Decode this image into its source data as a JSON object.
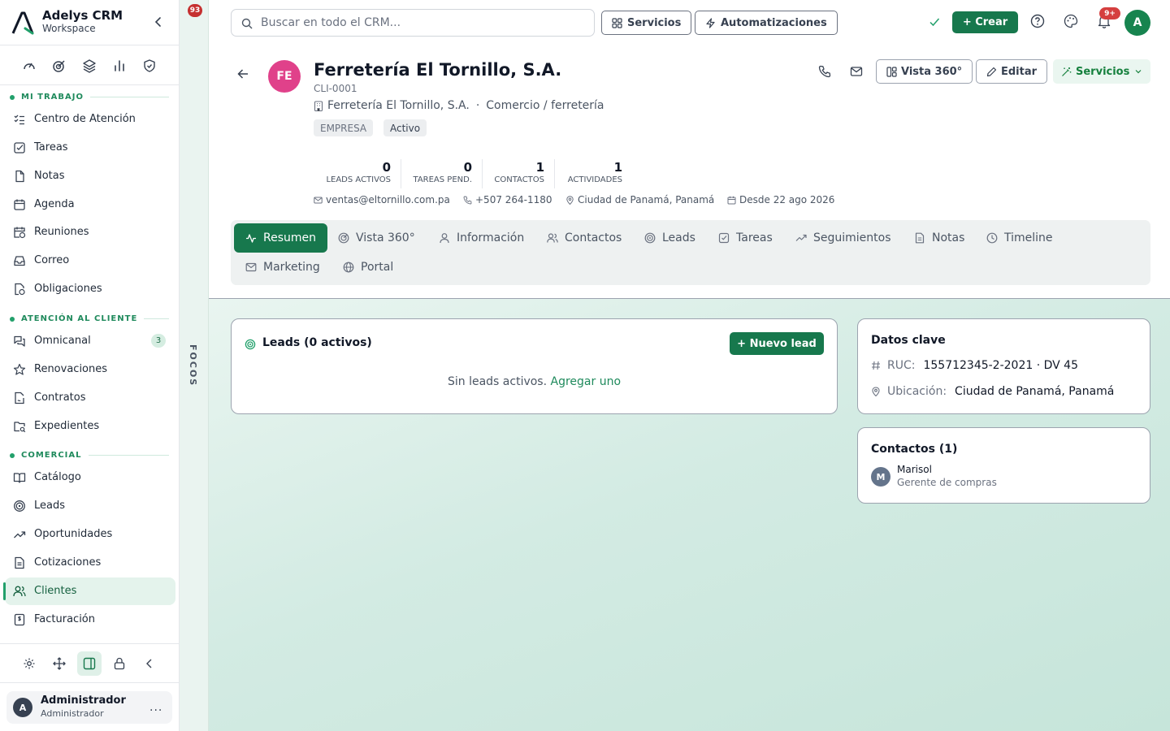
{
  "brand": {
    "name": "Adelys CRM",
    "workspace": "Workspace"
  },
  "sidebar": {
    "sections": [
      {
        "label": "MI TRABAJO",
        "items": [
          {
            "label": "Centro de Atención",
            "icon": "list-check-icon"
          },
          {
            "label": "Tareas",
            "icon": "checkbox-icon"
          },
          {
            "label": "Notas",
            "icon": "file-icon"
          },
          {
            "label": "Agenda",
            "icon": "calendar-icon"
          },
          {
            "label": "Reuniones",
            "icon": "calendar-clock-icon"
          },
          {
            "label": "Correo",
            "icon": "inbox-icon"
          },
          {
            "label": "Obligaciones",
            "icon": "file-clock-icon"
          }
        ]
      },
      {
        "label": "ATENCIÓN AL CLIENTE",
        "items": [
          {
            "label": "Omnicanal",
            "icon": "chat-icon",
            "badge": "3"
          },
          {
            "label": "Renovaciones",
            "icon": "star-icon"
          },
          {
            "label": "Contratos",
            "icon": "file-signature-icon"
          },
          {
            "label": "Expedientes",
            "icon": "folder-search-icon"
          }
        ]
      },
      {
        "label": "COMERCIAL",
        "items": [
          {
            "label": "Catálogo",
            "icon": "book-icon"
          },
          {
            "label": "Leads",
            "icon": "target-icon"
          },
          {
            "label": "Oportunidades",
            "icon": "trend-up-icon"
          },
          {
            "label": "Cotizaciones",
            "icon": "document-icon"
          },
          {
            "label": "Clientes",
            "icon": "users-icon",
            "active": true
          },
          {
            "label": "Facturación",
            "icon": "invoice-icon"
          }
        ]
      }
    ]
  },
  "user": {
    "initial": "A",
    "name": "Administrador",
    "role": "Administrador",
    "more": "..."
  },
  "focos": {
    "badge": "93",
    "label": "FOCOS"
  },
  "topbar": {
    "search_placeholder": "Buscar en todo el CRM...",
    "servicios_label": "Servicios",
    "automatizaciones_label": "Automatizaciones",
    "crear_label": "+ Crear",
    "notif_badge": "9+",
    "avatar_initial": "A"
  },
  "client": {
    "initials": "FE",
    "name": "Ferretería El Tornillo, S.A.",
    "code": "CLI-0001",
    "legal_name": "Ferretería El Tornillo, S.A.",
    "separator": "·",
    "industry": "Comercio / ferretería",
    "chips": [
      "EMPRESA",
      "Activo"
    ],
    "stats": [
      {
        "value": "0",
        "label": "LEADS ACTIVOS"
      },
      {
        "value": "0",
        "label": "TAREAS PEND."
      },
      {
        "value": "1",
        "label": "CONTACTOS"
      },
      {
        "value": "1",
        "label": "ACTIVIDADES"
      }
    ],
    "email": "ventas@eltornillo.com.pa",
    "phone": "+507 264-1180",
    "location": "Ciudad de Panamá, Panamá",
    "since": "Desde 22 ago 2026"
  },
  "header_actions": {
    "vista360_label": "Vista 360°",
    "editar_label": "Editar",
    "servicios_label": "Servicios"
  },
  "tabs": [
    {
      "label": "Resumen",
      "icon": "activity-icon",
      "active": true
    },
    {
      "label": "Vista 360°",
      "icon": "radar-icon"
    },
    {
      "label": "Información",
      "icon": "user-icon"
    },
    {
      "label": "Contactos",
      "icon": "users-icon"
    },
    {
      "label": "Leads",
      "icon": "target-icon"
    },
    {
      "label": "Tareas",
      "icon": "checkbox-icon"
    },
    {
      "label": "Seguimientos",
      "icon": "trend-up-icon"
    },
    {
      "label": "Notas",
      "icon": "document-icon"
    },
    {
      "label": "Timeline",
      "icon": "clock-icon"
    },
    {
      "label": "Marketing",
      "icon": "mail-icon"
    },
    {
      "label": "Portal",
      "icon": "globe-icon"
    }
  ],
  "leads_card": {
    "title": "Leads (0 activos)",
    "new_label": "+ Nuevo lead",
    "empty_text": "Sin leads activos.",
    "empty_link": "Agregar uno"
  },
  "key_data": {
    "title": "Datos clave",
    "ruc_label": "RUC:",
    "ruc_value": "155712345-2-2021 · DV 45",
    "location_label": "Ubicación:",
    "location_value": "Ciudad de Panamá, Panamá"
  },
  "contacts_card": {
    "title": "Contactos (1)",
    "contacts": [
      {
        "initial": "M",
        "name": "Marisol",
        "role": "Gerente de compras"
      }
    ]
  },
  "colors": {
    "primary": "#17784d",
    "accent": "#22a06b",
    "avatar_client": "#e0418a",
    "badge_red": "#d53f3f"
  }
}
